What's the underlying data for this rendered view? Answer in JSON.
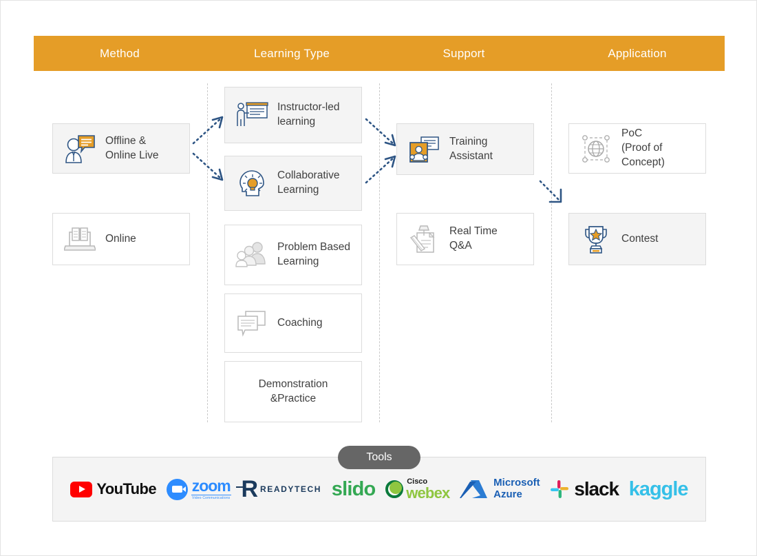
{
  "header": {
    "columns": [
      {
        "label": "Method"
      },
      {
        "label": "Learning Type"
      },
      {
        "label": "Support"
      },
      {
        "label": "Application"
      }
    ],
    "background_color": "#e59d27",
    "text_color": "#ffffff"
  },
  "columns": {
    "method": {
      "cards": [
        {
          "label": "Offline &\nOnline Live",
          "icon": "person-speech-bubble-icon",
          "filled": true
        },
        {
          "label": "Online",
          "icon": "laptop-book-icon",
          "filled": false
        }
      ]
    },
    "learning_type": {
      "cards": [
        {
          "label": "Instructor-led\nlearning",
          "icon": "presenter-whiteboard-icon",
          "filled": true
        },
        {
          "label": "Collaborative\nLearning",
          "icon": "head-lightbulb-icon",
          "filled": true
        },
        {
          "label": "Problem Based\nLearning",
          "icon": "group-people-icon",
          "filled": false
        },
        {
          "label": "Coaching",
          "icon": "speech-bubbles-icon",
          "filled": false
        },
        {
          "label": "Demonstration\n&Practice",
          "icon": "",
          "filled": false
        }
      ]
    },
    "support": {
      "cards": [
        {
          "label": "Training\nAssistant",
          "icon": "assistant-screen-icon",
          "filled": true
        },
        {
          "label": "Real Time\nQ&A",
          "icon": "pinned-note-pencil-icon",
          "filled": false
        }
      ]
    },
    "application": {
      "cards": [
        {
          "label": "PoC\n(Proof of Concept)",
          "icon": "globe-selection-icon",
          "filled": false
        },
        {
          "label": "Contest",
          "icon": "trophy-star-icon",
          "filled": true
        }
      ]
    }
  },
  "arrows": [
    {
      "name": "offline-to-instructor",
      "direction": "up-right"
    },
    {
      "name": "offline-to-collaborative",
      "direction": "down-right"
    },
    {
      "name": "instructor-to-training",
      "direction": "down-right"
    },
    {
      "name": "collaborative-to-training",
      "direction": "up-right"
    },
    {
      "name": "training-to-contest",
      "direction": "down-right"
    }
  ],
  "tools": {
    "badge_label": "Tools",
    "badge_color": "#666666",
    "logos": [
      {
        "name": "youtube-logo",
        "word": "YouTube",
        "color": "#ff0000"
      },
      {
        "name": "zoom-logo",
        "word": "zoom",
        "subtitle": "Video Communications",
        "color": "#2d8cff"
      },
      {
        "name": "readytech-logo",
        "mark": "R",
        "word": "READYTECH",
        "color": "#1b3a5c"
      },
      {
        "name": "slido-logo",
        "word": "slido",
        "color": "#34a853"
      },
      {
        "name": "webex-logo",
        "brand": "Cisco",
        "word": "webex",
        "color": "#8fc640"
      },
      {
        "name": "microsoft-azure-logo",
        "brand": "Microsoft",
        "word": "Azure",
        "color": "#1a5fb4"
      },
      {
        "name": "slack-logo",
        "word": "slack",
        "color": "#101010"
      },
      {
        "name": "kaggle-logo",
        "word": "kaggle",
        "color": "#35c0e8"
      }
    ]
  }
}
